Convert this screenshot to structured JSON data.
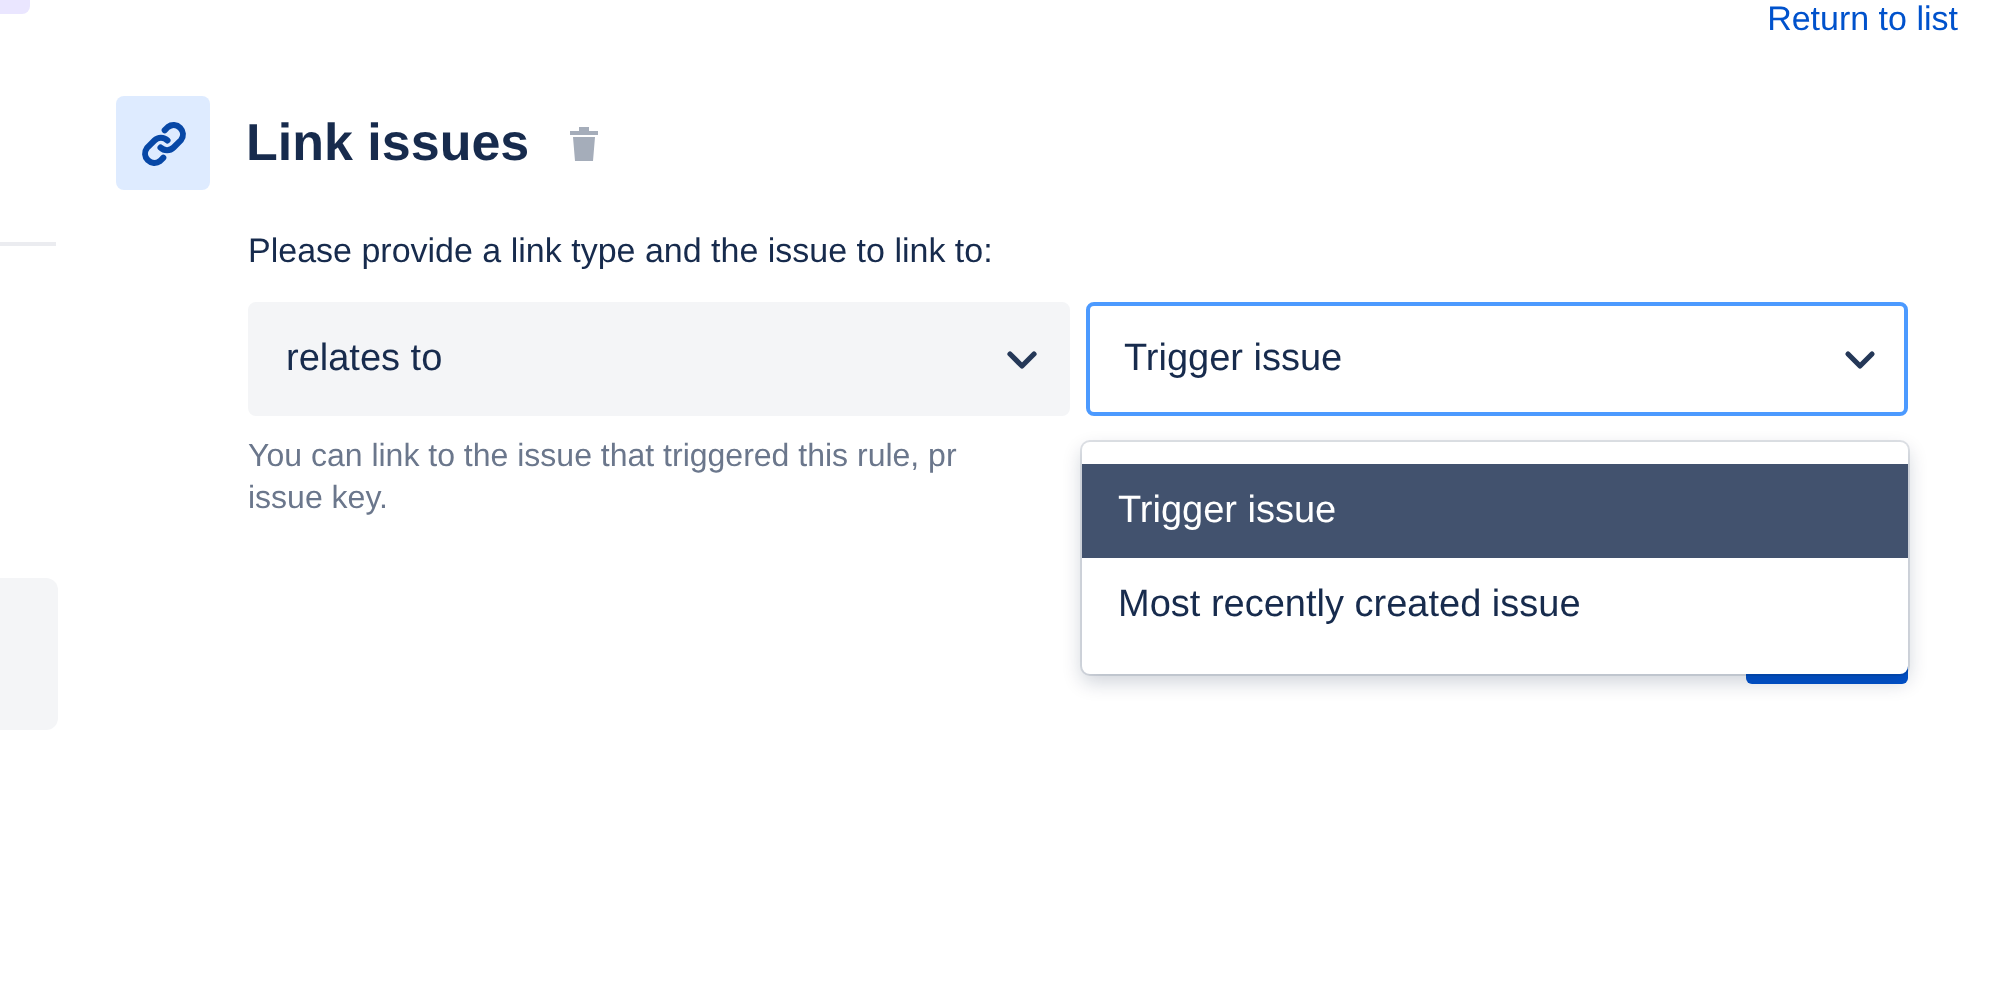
{
  "header": {
    "return_link": "Return to list"
  },
  "action": {
    "title": "Link issues",
    "prompt": "Please provide a link type and the issue to link to:",
    "link_type": {
      "value": "relates to"
    },
    "issue": {
      "value": "Trigger issue",
      "focused": true,
      "expanded": true,
      "options": [
        {
          "label": "Trigger issue",
          "selected": true
        },
        {
          "label": "Most recently created issue",
          "selected": false
        }
      ]
    },
    "help_lines": [
      "You can link to the issue that triggered this rule, pr",
      "issue key."
    ]
  }
}
